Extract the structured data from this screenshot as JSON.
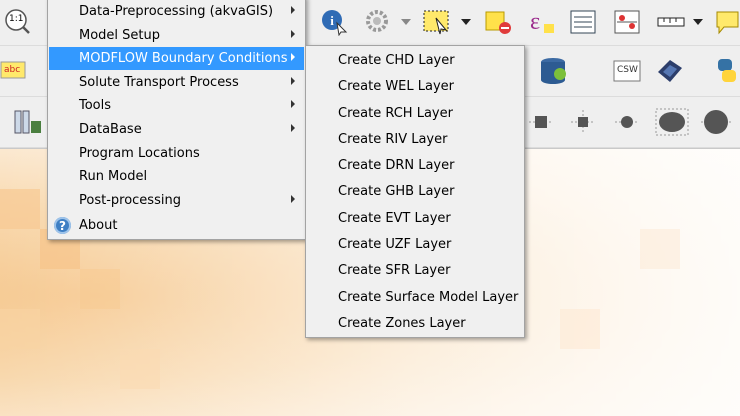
{
  "main_menu": {
    "items": [
      {
        "label": "Data-Preprocessing (akvaGIS)",
        "submenu": true
      },
      {
        "label": "Model Setup",
        "submenu": true
      },
      {
        "label": "MODFLOW Boundary Conditions",
        "submenu": true,
        "active": true
      },
      {
        "label": "Solute Transport Process",
        "submenu": true
      },
      {
        "label": "Tools",
        "submenu": true
      },
      {
        "label": "DataBase",
        "submenu": true
      },
      {
        "label": "Program Locations",
        "submenu": false
      },
      {
        "label": "Run Model",
        "submenu": false
      },
      {
        "label": "Post-processing",
        "submenu": true
      },
      {
        "label": "About",
        "submenu": false
      }
    ]
  },
  "submenu": {
    "items": [
      "Create CHD Layer",
      "Create WEL Layer",
      "Create RCH Layer",
      "Create RIV Layer",
      "Create DRN Layer",
      "Create GHB Layer",
      "Create EVT Layer",
      "Create UZF Layer",
      "Create SFR Layer",
      "Create Surface Model Layer",
      "Create Zones Layer"
    ]
  },
  "toolbar": {
    "zoom_label": "1:1",
    "abc_label": "abc",
    "csw_label": "CSW"
  },
  "colors": {
    "highlight": "#3399ff",
    "menu_bg": "#f0f0f0"
  }
}
